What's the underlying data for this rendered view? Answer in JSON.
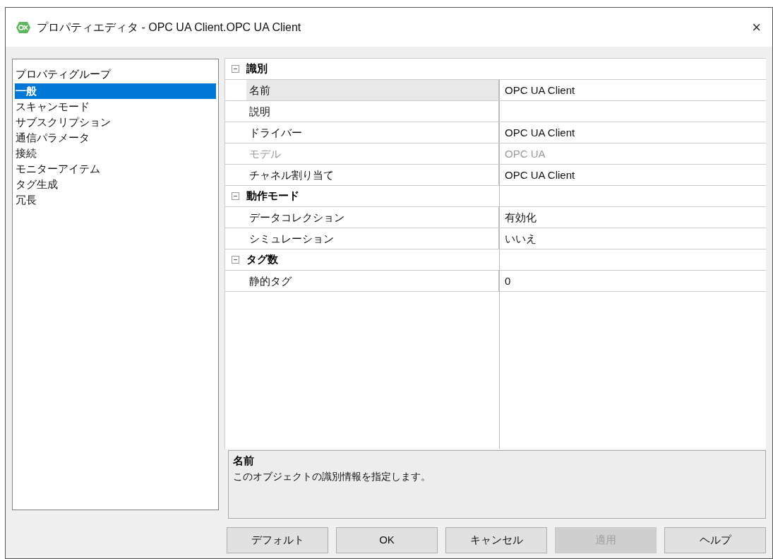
{
  "window": {
    "title": "プロパティエディタ - OPC UA Client.OPC UA Client",
    "close": "×"
  },
  "sidebar": {
    "heading": "プロパティグループ",
    "items": [
      {
        "label": "一般",
        "selected": true
      },
      {
        "label": "スキャンモード",
        "selected": false
      },
      {
        "label": "サブスクリプション",
        "selected": false
      },
      {
        "label": "通信パラメータ",
        "selected": false
      },
      {
        "label": "接続",
        "selected": false
      },
      {
        "label": "モニターアイテム",
        "selected": false
      },
      {
        "label": "タグ生成",
        "selected": false
      },
      {
        "label": "冗長",
        "selected": false
      }
    ]
  },
  "property_grid": {
    "groups": [
      {
        "label": "識別",
        "expanded": true,
        "rows": [
          {
            "name": "名前",
            "value": "OPC UA Client",
            "selected": true,
            "disabled": false
          },
          {
            "name": "説明",
            "selected": false,
            "disabled": false
          },
          {
            "name": "ドライバー",
            "value": "OPC UA Client",
            "selected": false,
            "disabled": false
          },
          {
            "name": "モデル",
            "value": "OPC UA",
            "selected": false,
            "disabled": true
          },
          {
            "name": "チャネル割り当て",
            "value": "OPC UA Client",
            "selected": false,
            "disabled": false
          }
        ]
      },
      {
        "label": "動作モード",
        "expanded": true,
        "rows": [
          {
            "name": "データコレクション",
            "value": "有効化",
            "selected": false,
            "disabled": false
          },
          {
            "name": "シミュレーション",
            "value": "いいえ",
            "selected": false,
            "disabled": false
          }
        ]
      },
      {
        "label": "タグ数",
        "expanded": true,
        "rows": [
          {
            "name": "静的タグ",
            "value": "0",
            "selected": false,
            "disabled": false
          }
        ]
      }
    ]
  },
  "description": {
    "title": "名前",
    "text": "このオブジェクトの識別情報を指定します。"
  },
  "buttons": [
    {
      "label": "デフォルト",
      "disabled": false
    },
    {
      "label": "OK",
      "disabled": false
    },
    {
      "label": "キャンセル",
      "disabled": false
    },
    {
      "label": "適用",
      "disabled": true
    },
    {
      "label": "ヘルプ",
      "disabled": false
    }
  ]
}
